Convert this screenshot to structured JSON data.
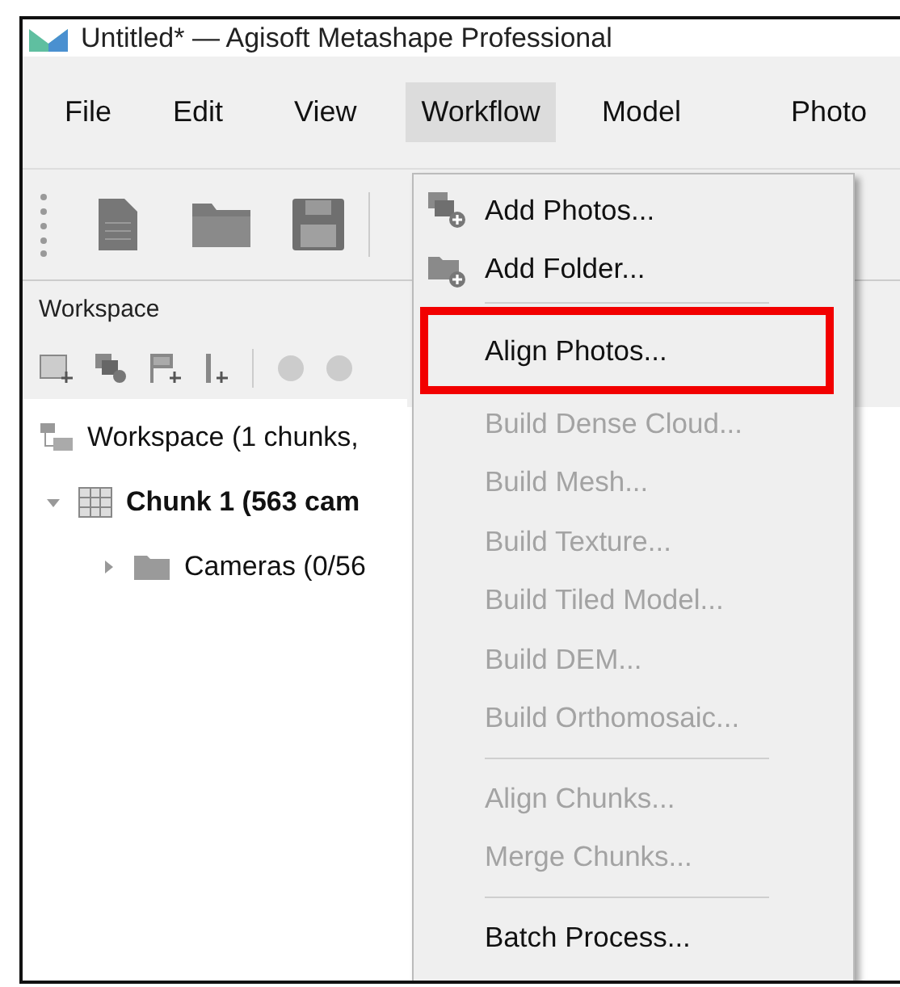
{
  "window": {
    "title": "Untitled* — Agisoft Metashape Professional"
  },
  "menu_bar": [
    {
      "label": "File",
      "selected": false
    },
    {
      "label": "Edit",
      "selected": false
    },
    {
      "label": "View",
      "selected": false
    },
    {
      "label": "Workflow",
      "selected": true
    },
    {
      "label": "Model",
      "selected": false
    },
    {
      "label": "Photo",
      "selected": false
    }
  ],
  "workspace": {
    "title": "Workspace",
    "tree": [
      {
        "label": "Workspace (1 chunks,",
        "bold": false,
        "children": [
          {
            "label": "Chunk 1 (563 cam",
            "bold": true,
            "expanded": true,
            "children": [
              {
                "label": "Cameras (0/56",
                "bold": false,
                "expanded": false
              }
            ]
          }
        ]
      }
    ]
  },
  "workflow_menu": [
    {
      "kind": "item",
      "label": "Add Photos...",
      "disabled": false,
      "highlighted": false
    },
    {
      "kind": "item",
      "label": "Add Folder...",
      "disabled": false,
      "highlighted": false
    },
    {
      "kind": "separator"
    },
    {
      "kind": "item",
      "label": "Align Photos...",
      "disabled": false,
      "highlighted": true
    },
    {
      "kind": "item",
      "label": "Build Dense Cloud...",
      "disabled": true,
      "highlighted": false
    },
    {
      "kind": "item",
      "label": "Build Mesh...",
      "disabled": true,
      "highlighted": false
    },
    {
      "kind": "item",
      "label": "Build Texture...",
      "disabled": true,
      "highlighted": false
    },
    {
      "kind": "item",
      "label": "Build Tiled Model...",
      "disabled": true,
      "highlighted": false
    },
    {
      "kind": "item",
      "label": "Build DEM...",
      "disabled": true,
      "highlighted": false
    },
    {
      "kind": "item",
      "label": "Build Orthomosaic...",
      "disabled": true,
      "highlighted": false
    },
    {
      "kind": "separator"
    },
    {
      "kind": "item",
      "label": "Align Chunks...",
      "disabled": true,
      "highlighted": false
    },
    {
      "kind": "item",
      "label": "Merge Chunks...",
      "disabled": true,
      "highlighted": false
    },
    {
      "kind": "separator"
    },
    {
      "kind": "item",
      "label": "Batch Process...",
      "disabled": false,
      "highlighted": false
    }
  ]
}
